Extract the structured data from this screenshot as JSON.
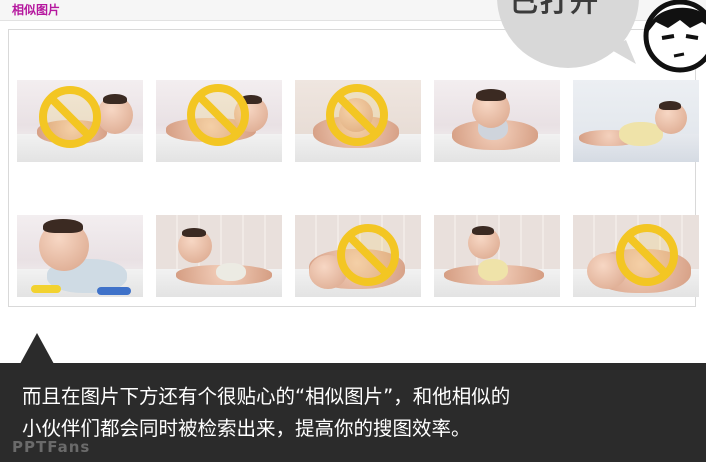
{
  "header": {
    "title": "相似图片"
  },
  "bubble": {
    "text": "已打开"
  },
  "gallery": {
    "rows": [
      [
        {
          "label": "baby-photo-1",
          "blocked": true
        },
        {
          "label": "baby-photo-2",
          "blocked": true
        },
        {
          "label": "baby-photo-3",
          "blocked": true
        },
        {
          "label": "baby-photo-4",
          "blocked": false
        },
        {
          "label": "baby-photo-5",
          "blocked": false
        }
      ],
      [
        {
          "label": "baby-photo-6",
          "blocked": false
        },
        {
          "label": "baby-photo-7",
          "blocked": false
        },
        {
          "label": "baby-photo-8",
          "blocked": true
        },
        {
          "label": "baby-photo-9",
          "blocked": false
        },
        {
          "label": "baby-photo-10",
          "blocked": true
        }
      ]
    ]
  },
  "caption": {
    "line1": "而且在图片下方还有个很贴心的“相似图片”，和他相似的",
    "line2": "小伙伴们都会同时被检索出来，提高你的搜图效率。"
  },
  "watermark": {
    "text": "PPTFans"
  },
  "colors": {
    "title": "#b5179e",
    "ban": "#f3c623",
    "caption_bg": "#2b2b2b"
  },
  "icons": {
    "blocked_marker": "prohibited-icon"
  }
}
